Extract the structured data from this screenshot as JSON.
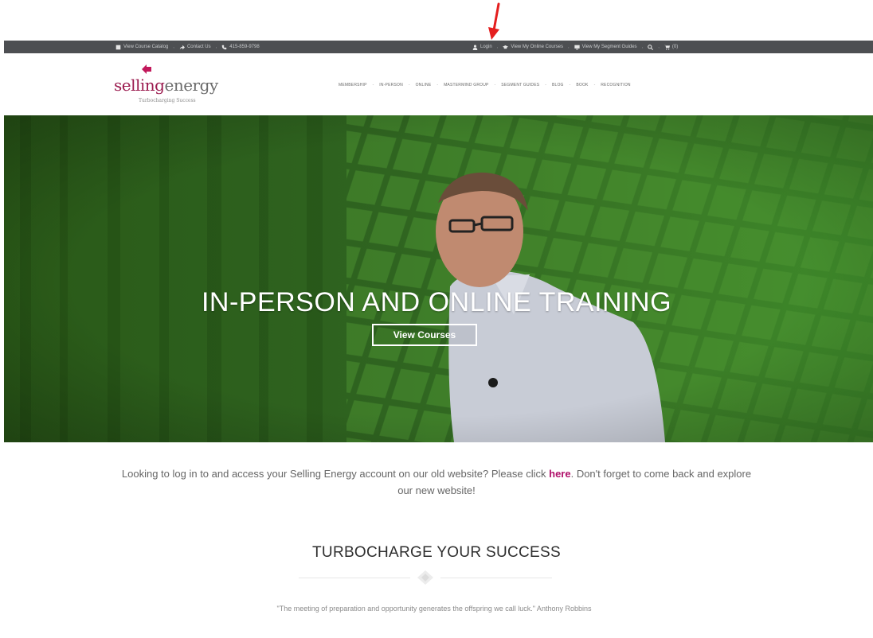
{
  "top_bar": {
    "catalog": "View Course Catalog",
    "contact": "Contact Us",
    "phone": "415-859-9798",
    "login": "Login",
    "online_courses": "View My Online Courses",
    "segment_guides": "View My Segment Guides",
    "cart_count": "(0)"
  },
  "logo": {
    "part1": "selling",
    "part2": "energy",
    "tagline": "Turbocharging Success"
  },
  "nav": [
    {
      "label": "MEMBERSHIP"
    },
    {
      "label": "IN-PERSON"
    },
    {
      "label": "ONLINE"
    },
    {
      "label": "MASTERMIND GROUP"
    },
    {
      "label": "SEGMENT GUIDES"
    },
    {
      "label": "BLOG"
    },
    {
      "label": "BOOK"
    },
    {
      "label": "RECOGNITION"
    }
  ],
  "hero": {
    "title": "IN-PERSON AND ONLINE TRAINING",
    "button": "View Courses"
  },
  "notice": {
    "before": "Looking to log in to and access your Selling Energy account on our old website? Please click ",
    "link": "here",
    "after": ". Don't forget to come back and explore our new website!"
  },
  "section": {
    "title": "TURBOCHARGE YOUR SUCCESS",
    "quote": "\"The meeting of preparation and opportunity generates the offspring we call luck.\" Anthony Robbins"
  },
  "colors": {
    "topbar": "#4d4f52",
    "brand": "#9b1b4f",
    "hero_green": "#2d5c1c",
    "link": "#b0106a",
    "annotation": "#e41e1e"
  },
  "icons": [
    "book-icon",
    "share-icon",
    "phone-icon",
    "user-icon",
    "graduation-cap-icon",
    "monitor-icon",
    "search-icon",
    "cart-icon"
  ]
}
